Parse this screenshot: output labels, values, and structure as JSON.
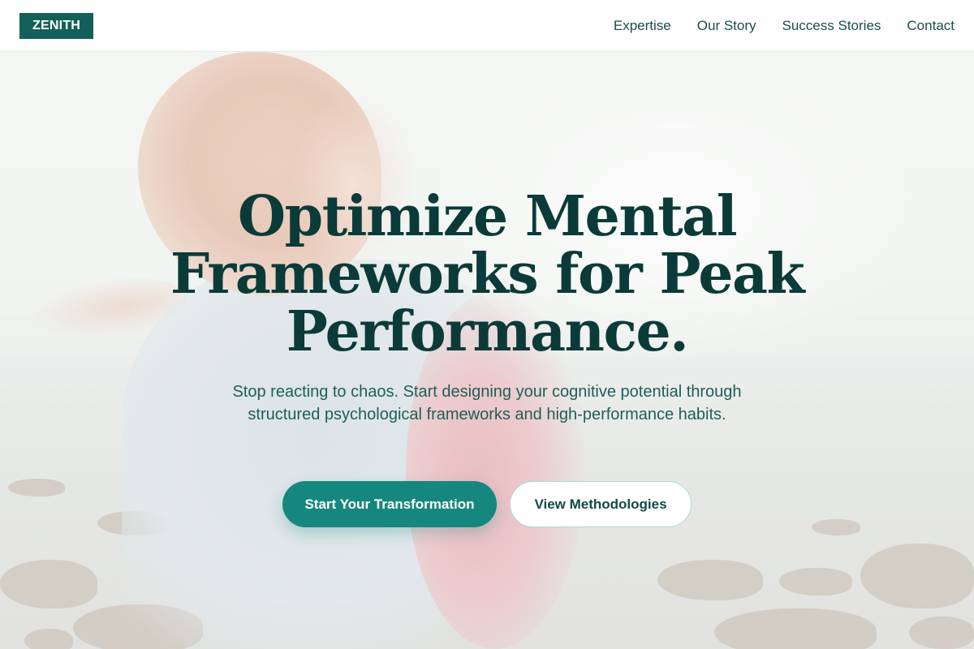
{
  "brand": {
    "logo_text": "ZENITH"
  },
  "nav": {
    "items": [
      {
        "label": "Expertise"
      },
      {
        "label": "Our Story"
      },
      {
        "label": "Success Stories"
      },
      {
        "label": "Contact"
      }
    ]
  },
  "hero": {
    "headline": "Optimize Mental Frameworks for Peak Performance.",
    "subtitle": "Stop reacting to chaos. Start designing your cognitive potential through structured psychological frameworks and high-performance habits.",
    "primary_cta": "Start Your Transformation",
    "secondary_cta": "View Methodologies",
    "background_image": "woman-with-open-arms-at-seaside-photo"
  },
  "colors": {
    "brand_dark": "#13605a",
    "headline": "#0b3b38",
    "accent": "#16877f",
    "secondary_border": "#a8ddd6"
  }
}
